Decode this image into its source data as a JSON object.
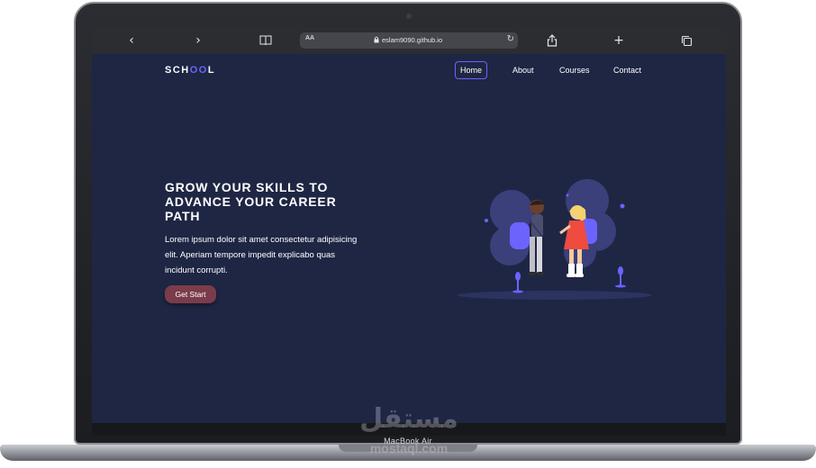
{
  "browser": {
    "back_icon": "chevron-left",
    "forward_icon": "chevron-right",
    "bookmarks_icon": "book",
    "text_size_label": "AA",
    "url": "eslam9090.github.io",
    "share_icon": "share",
    "new_tab_icon": "plus",
    "tabs_icon": "tabs"
  },
  "site": {
    "brand": {
      "prefix": "SCH",
      "accent": "OO",
      "suffix": "L"
    },
    "nav": [
      {
        "label": "Home",
        "active": true
      },
      {
        "label": "About",
        "active": false
      },
      {
        "label": "Courses",
        "active": false
      },
      {
        "label": "Contact",
        "active": false
      }
    ],
    "hero": {
      "title": "GROW YOUR SKILLS TO ADVANCE YOUR CAREER PATH",
      "text": "Lorem ipsum dolor sit amet consectetur adipisicing elit. Aperiam tempore impedit explicabo quas incidunt corrupti.",
      "cta_label": "Get Start"
    }
  },
  "device": {
    "model": "MacBook Air",
    "watermark": "مستقل",
    "watermark_sub": "mostaql.com"
  },
  "colors": {
    "page_bg": "#1f2644",
    "accent": "#6c63ff",
    "cta_bg": "#7a3c4a",
    "toolbar_bg": "#2b2d31"
  }
}
